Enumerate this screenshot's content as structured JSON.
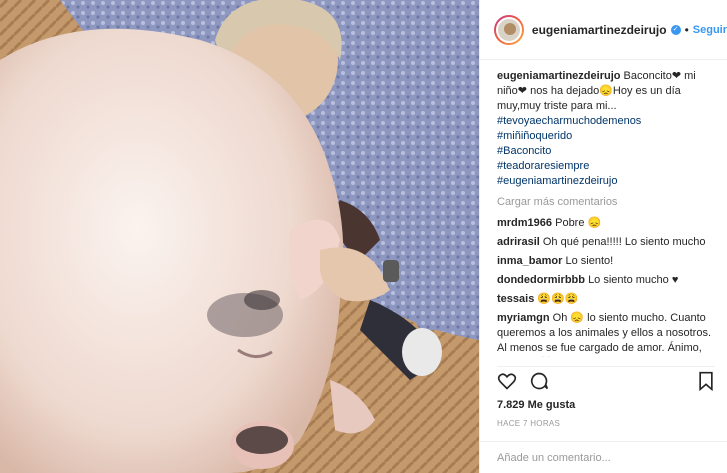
{
  "post": {
    "username": "eugeniamartinezdeirujo",
    "verified_symbol": "✓",
    "dot": "•",
    "follow_label": "Seguir",
    "caption": {
      "user": "eugeniamartinezdeirujo",
      "text": "Baconcito❤ mi niño❤ nos ha dejado😞Hoy es un día muy,muy triste para mi...",
      "hashtags": [
        "#tevoyaecharmuchodemenos",
        "#miñiñoquerido",
        "#Baconcito",
        "#teadoraresiempre",
        "#eugeniamartinezdeirujo"
      ]
    },
    "load_more": "Cargar más comentarios",
    "comments": [
      {
        "user": "mrdm1966",
        "text": "Pobre 😞"
      },
      {
        "user": "adrirasil",
        "text": "Oh qué pena!!!!! Lo siento mucho"
      },
      {
        "user": "inma_bamor",
        "text": "Lo siento!"
      },
      {
        "user": "dondedormirbbb",
        "text": "Lo siento mucho ♥"
      },
      {
        "user": "tessais",
        "text": "😩😩😩"
      },
      {
        "user": "myriamgn",
        "text": "Oh 😞 lo siento mucho. Cuanto queremos a los animales y ellos a nosotros. Al menos se fue cargado de amor. Ánimo, un beso 💗"
      }
    ],
    "likes": "7.829 Me gusta",
    "time": "HACE 7 HORAS",
    "add_comment_placeholder": "Añade un comentario..."
  }
}
